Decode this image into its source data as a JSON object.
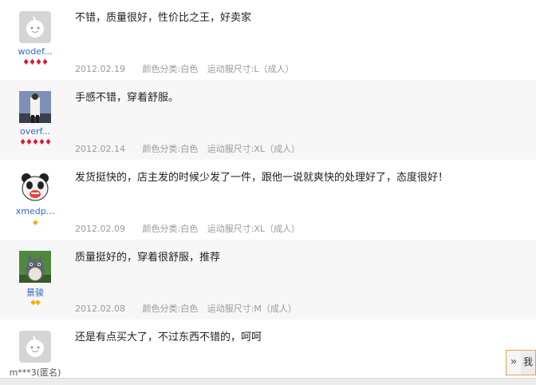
{
  "reviews": [
    {
      "user": "wodef...",
      "content": "不错，质量很好，性价比之王，好卖家",
      "date": "2012.02.19",
      "attr_color": "颜色分类:白色",
      "attr_size": "运动服尺寸:L（成人）",
      "rank": "♦♦♦♦"
    },
    {
      "user": "overf...",
      "content": "手感不错，穿着舒服。",
      "date": "2012.02.14",
      "attr_color": "颜色分类:白色",
      "attr_size": "运动服尺寸:XL（成人）",
      "rank": "♦♦♦♦♦"
    },
    {
      "user": "xmedp...",
      "content": "发货挺快的，店主发的时候少发了一件，跟他一说就爽快的处理好了，态度很好！",
      "date": "2012.02.09",
      "attr_color": "颜色分类:白色",
      "attr_size": "运动服尺寸:XL（成人）",
      "rank": "◆"
    },
    {
      "user": "景骏",
      "content": "质量挺好的，穿着很舒服，推荐",
      "date": "2012.02.08",
      "attr_color": "颜色分类:白色",
      "attr_size": "运动服尺寸:M（成人）",
      "rank": "◆◆"
    },
    {
      "user": "m***3(匿名)",
      "content": "还是有点买大了，不过东西不错的，呵呵"
    }
  ],
  "scroll_control": {
    "arrow": "»",
    "side_label": "我"
  }
}
